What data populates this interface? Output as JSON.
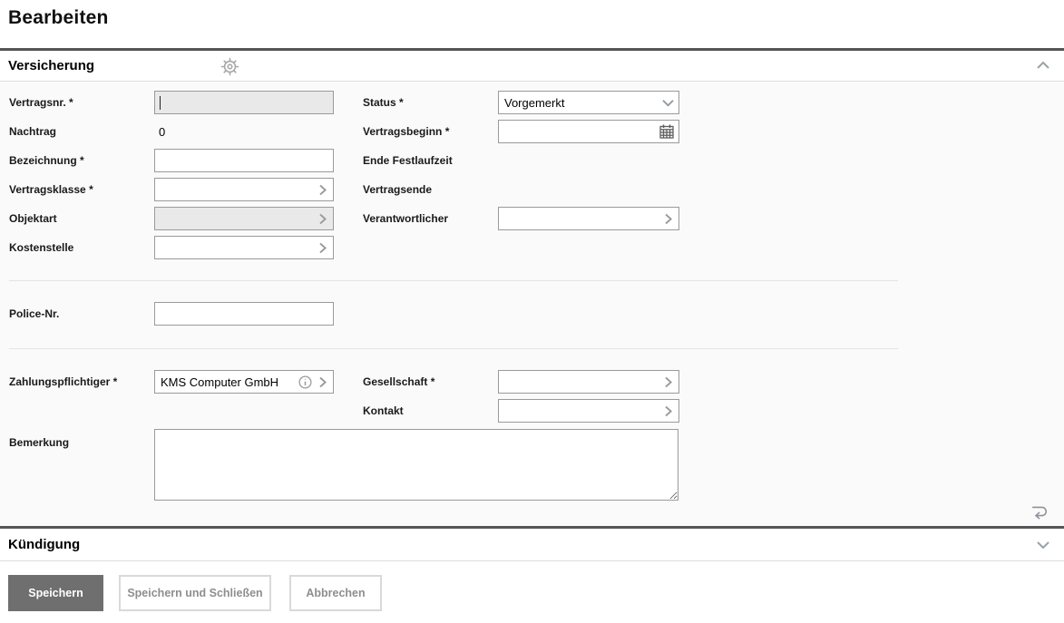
{
  "page": {
    "title": "Bearbeiten"
  },
  "sections": {
    "versicherung": {
      "title": "Versicherung",
      "collapse_state": "expanded"
    },
    "kuendigung": {
      "title": "Kündigung",
      "collapse_state": "collapsed"
    }
  },
  "fields": {
    "vertragsnr": {
      "label": "Vertragsnr. *",
      "value": "",
      "disabled": true,
      "focused": true
    },
    "nachtrag": {
      "label": "Nachtrag",
      "value": "0"
    },
    "bezeichnung": {
      "label": "Bezeichnung *",
      "value": ""
    },
    "vertragsklasse": {
      "label": "Vertragsklasse *",
      "value": ""
    },
    "objektart": {
      "label": "Objektart",
      "value": "",
      "disabled": true
    },
    "kostenstelle": {
      "label": "Kostenstelle",
      "value": ""
    },
    "status": {
      "label": "Status *",
      "value": "Vorgemerkt"
    },
    "vertragsbeginn": {
      "label": "Vertragsbeginn *",
      "value": ""
    },
    "ende_festlaufzeit": {
      "label": "Ende Festlaufzeit"
    },
    "vertragsende": {
      "label": "Vertragsende"
    },
    "verantwortlicher": {
      "label": "Verantwortlicher",
      "value": ""
    },
    "police_nr": {
      "label": "Police-Nr.",
      "value": ""
    },
    "zahlungspflichtiger": {
      "label": "Zahlungspflichtiger *",
      "value": "KMS Computer GmbH"
    },
    "gesellschaft": {
      "label": "Gesellschaft *",
      "value": ""
    },
    "kontakt": {
      "label": "Kontakt",
      "value": ""
    },
    "bemerkung": {
      "label": "Bemerkung",
      "value": ""
    }
  },
  "buttons": {
    "speichern": "Speichern",
    "speichern_und_schliessen": "Speichern und Schließen",
    "abbrechen": "Abbrechen"
  },
  "icons": {
    "gear": "settings-gear",
    "chevron_up": "collapse-section",
    "chevron_down": "expand-section",
    "picker": "open-lookup",
    "info": "info",
    "calendar": "date-picker",
    "undo": "revert-changes"
  },
  "colors": {
    "section_rule": "#555555",
    "body_bg": "#fafafa",
    "input_border": "#9a9a9a",
    "disabled_bg": "#e9e9e9",
    "primary_button_bg": "#6f6f6f",
    "secondary_button_text": "#8e8e8e",
    "icon_gray": "#9aa0a6"
  }
}
